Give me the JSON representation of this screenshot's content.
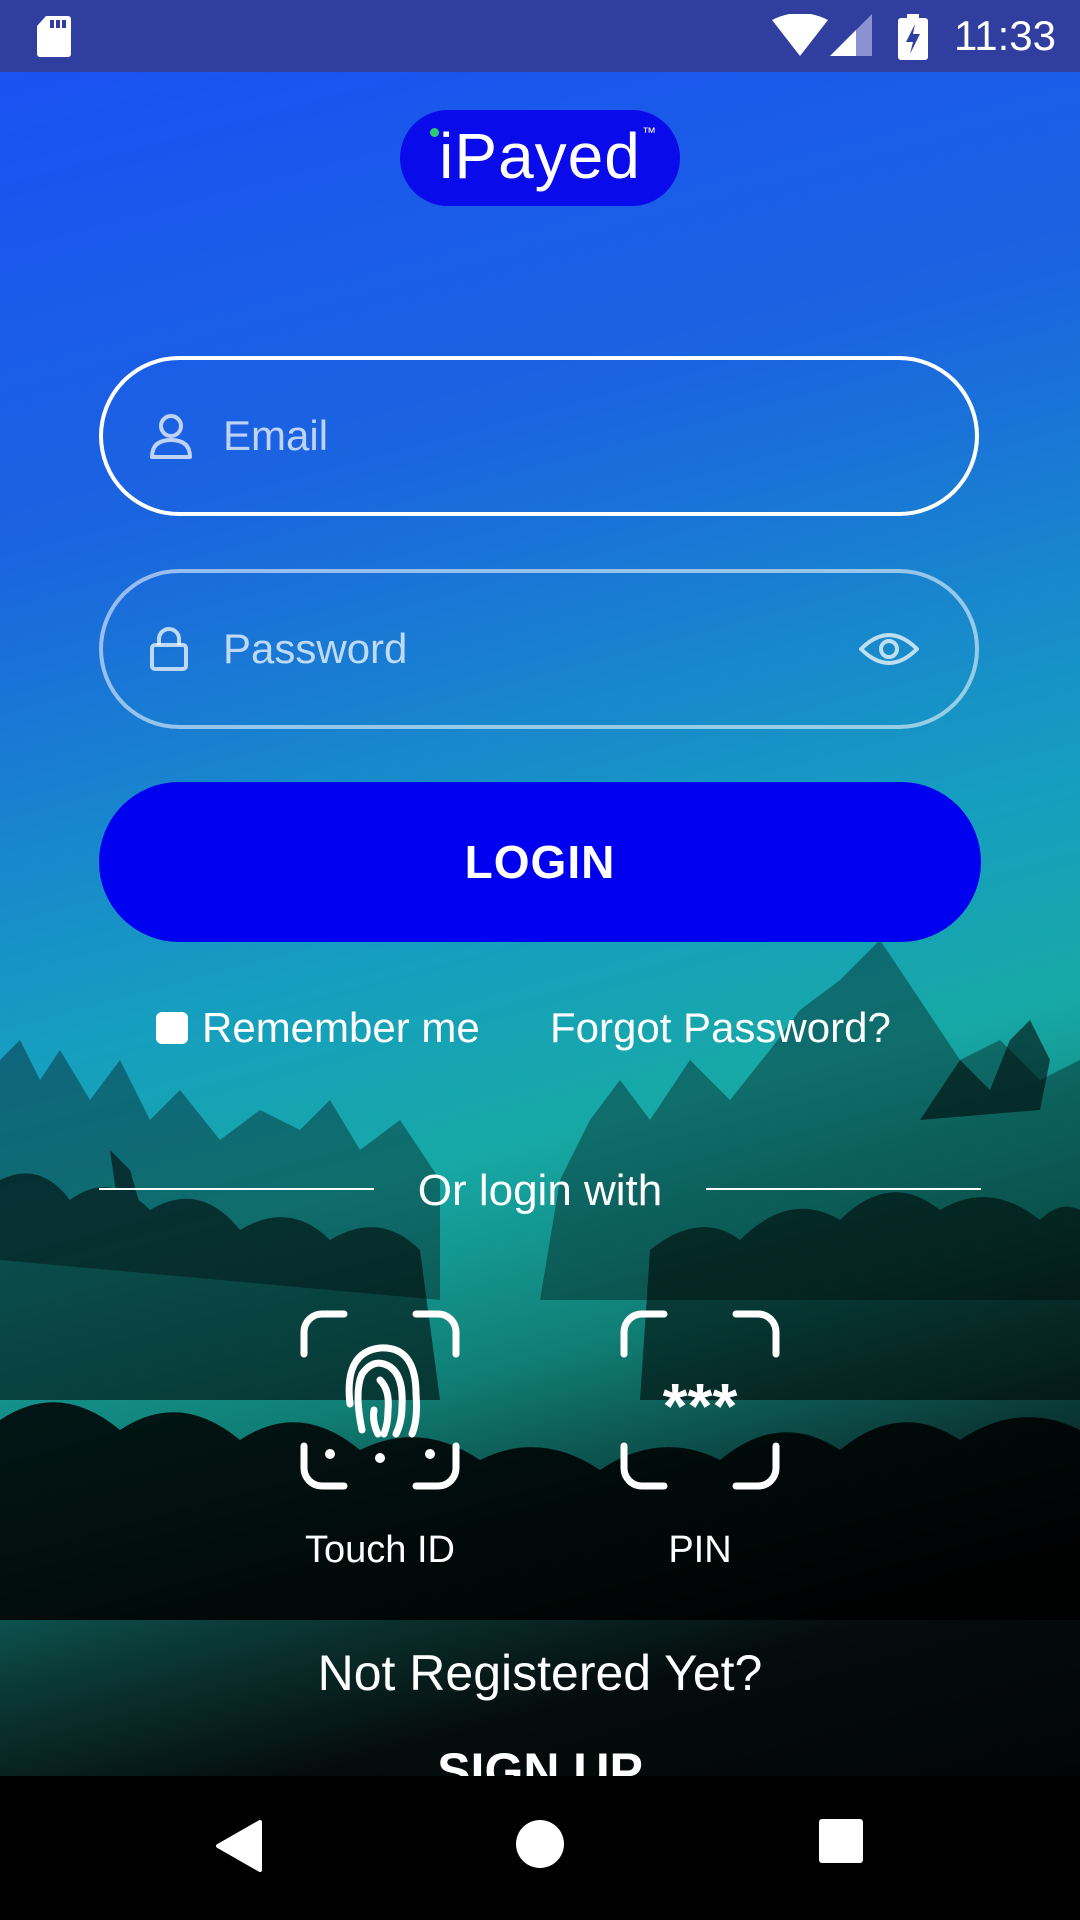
{
  "status_bar": {
    "time": "11:33",
    "icons": [
      "sd-card-icon",
      "wifi-icon",
      "cell-signal-icon",
      "battery-charging-icon"
    ]
  },
  "logo": {
    "text": "iPayed",
    "trademark": "™"
  },
  "email_field": {
    "placeholder": "Email",
    "icon": "person-icon"
  },
  "password_field": {
    "placeholder": "Password",
    "icon": "lock-icon",
    "toggle_icon": "eye-icon"
  },
  "login_button": {
    "label": "LOGIN"
  },
  "remember_me": {
    "label": "Remember me",
    "checked": false
  },
  "forgot_password": {
    "label": "Forgot Password?"
  },
  "alt_login": {
    "heading": "Or login with",
    "options": [
      {
        "label": "Touch ID",
        "icon": "fingerprint-icon"
      },
      {
        "label": "PIN",
        "icon": "pin-icon",
        "glyph": "***"
      }
    ]
  },
  "register": {
    "prompt": "Not Registered Yet?",
    "signup_label": "SIGN UP"
  },
  "nav_bar": {
    "buttons": [
      "back-icon",
      "home-icon",
      "recents-icon"
    ]
  },
  "colors": {
    "status_bar": "#303f9f",
    "logo_bg": "#0a0bea",
    "login_button": "#0000f0",
    "gradient_top": "#1a4ff6",
    "gradient_mid": "#17a9a6"
  }
}
